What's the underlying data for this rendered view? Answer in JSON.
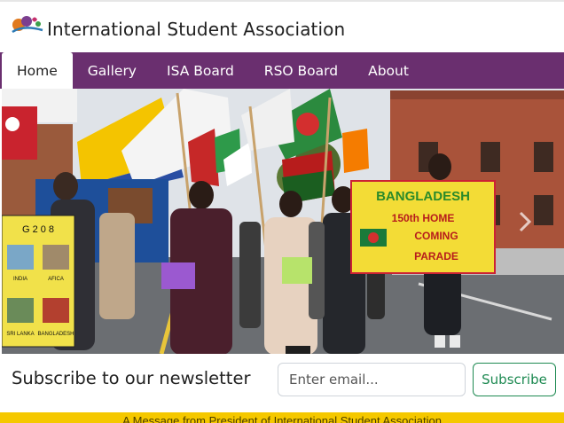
{
  "site": {
    "title": "International Student Association"
  },
  "nav": {
    "items": [
      {
        "label": "Home",
        "active": true
      },
      {
        "label": "Gallery",
        "active": false
      },
      {
        "label": "ISA Board",
        "active": false
      },
      {
        "label": "RSO Board",
        "active": false
      },
      {
        "label": "About",
        "active": false
      }
    ]
  },
  "hero": {
    "signs": {
      "left": [
        "G 2 0 8",
        "INDIA",
        "AFICA",
        "SRI LANKA",
        "BANGLADESH"
      ],
      "right": [
        "BANGLADESH",
        "150th HOME",
        "COMING",
        "PARADE"
      ]
    }
  },
  "newsletter": {
    "heading": "Subscribe to our newsletter",
    "email_placeholder": "Enter email...",
    "subscribe_label": "Subscribe"
  },
  "announcement": {
    "text": "A Message from President of International Student Association"
  },
  "colors": {
    "nav_bg": "#6a2f6f",
    "announce_bg": "#f5c800",
    "accent_green": "#1e8a52"
  },
  "icons": {
    "logo": "isa-logo-icon"
  }
}
